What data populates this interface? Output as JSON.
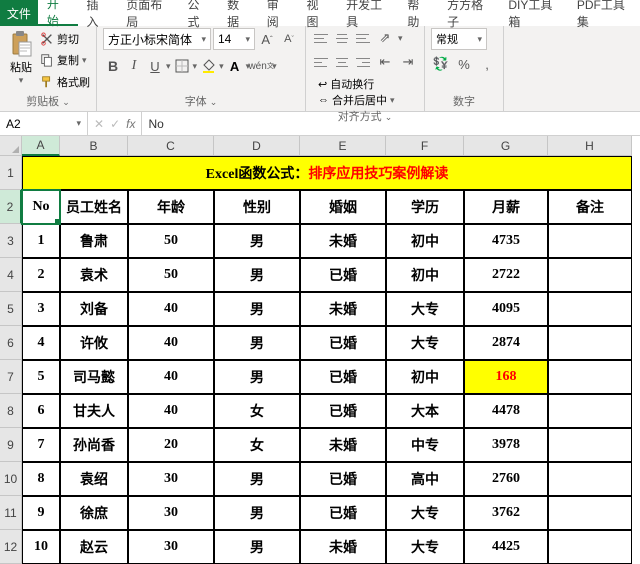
{
  "tabs": {
    "file": "文件",
    "items": [
      "开始",
      "插入",
      "页面布局",
      "公式",
      "数据",
      "审阅",
      "视图",
      "开发工具",
      "帮助",
      "方方格子",
      "DIY工具箱",
      "PDF工具集"
    ],
    "active": "开始"
  },
  "ribbon": {
    "clipboard": {
      "paste": "粘贴",
      "cut": "剪切",
      "copy": "复制",
      "format_painter": "格式刷",
      "label": "剪贴板"
    },
    "font": {
      "name": "方正小标宋简体",
      "size": "14",
      "label": "字体"
    },
    "align": {
      "wrap": "自动换行",
      "merge": "合并后居中",
      "label": "对齐方式"
    },
    "number": {
      "format": "常规",
      "label": "数字"
    }
  },
  "formula_bar": {
    "name_box": "A2",
    "fx": "fx",
    "value": "No"
  },
  "columns": [
    "A",
    "B",
    "C",
    "D",
    "E",
    "F",
    "G",
    "H"
  ],
  "active_col_index": 0,
  "title": {
    "prefix": "Excel函数公式：",
    "suffix": "排序应用技巧案例解读"
  },
  "headers": [
    "No",
    "员工姓名",
    "年龄",
    "性别",
    "婚姻",
    "学历",
    "月薪",
    "备注"
  ],
  "rows": [
    {
      "no": "1",
      "name": "鲁肃",
      "age": "50",
      "sex": "男",
      "marry": "未婚",
      "edu": "初中",
      "salary": "4735",
      "note": ""
    },
    {
      "no": "2",
      "name": "袁术",
      "age": "50",
      "sex": "男",
      "marry": "已婚",
      "edu": "初中",
      "salary": "2722",
      "note": ""
    },
    {
      "no": "3",
      "name": "刘备",
      "age": "40",
      "sex": "男",
      "marry": "未婚",
      "edu": "大专",
      "salary": "4095",
      "note": ""
    },
    {
      "no": "4",
      "name": "许攸",
      "age": "40",
      "sex": "男",
      "marry": "已婚",
      "edu": "大专",
      "salary": "2874",
      "note": ""
    },
    {
      "no": "5",
      "name": "司马懿",
      "age": "40",
      "sex": "男",
      "marry": "已婚",
      "edu": "初中",
      "salary": "168",
      "note": "",
      "hl": true
    },
    {
      "no": "6",
      "name": "甘夫人",
      "age": "40",
      "sex": "女",
      "marry": "已婚",
      "edu": "大本",
      "salary": "4478",
      "note": ""
    },
    {
      "no": "7",
      "name": "孙尚香",
      "age": "20",
      "sex": "女",
      "marry": "未婚",
      "edu": "中专",
      "salary": "3978",
      "note": ""
    },
    {
      "no": "8",
      "name": "袁绍",
      "age": "30",
      "sex": "男",
      "marry": "已婚",
      "edu": "高中",
      "salary": "2760",
      "note": ""
    },
    {
      "no": "9",
      "name": "徐庶",
      "age": "30",
      "sex": "男",
      "marry": "已婚",
      "edu": "大专",
      "salary": "3762",
      "note": ""
    },
    {
      "no": "10",
      "name": "赵云",
      "age": "30",
      "sex": "男",
      "marry": "未婚",
      "edu": "大专",
      "salary": "4425",
      "note": ""
    }
  ],
  "active_row": 2
}
